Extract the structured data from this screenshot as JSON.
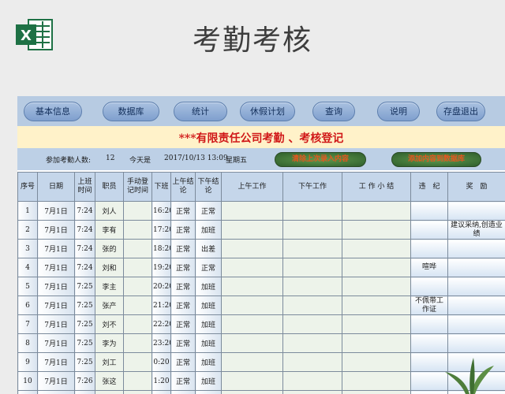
{
  "header": {
    "title": "考勤考核"
  },
  "nav": {
    "buttons": [
      "基本信息",
      "数据库",
      "统计",
      "休假计划",
      "查询",
      "说明",
      "存盘退出"
    ]
  },
  "banner": {
    "title": "***有限责任公司考勤 、考核登记"
  },
  "info": {
    "count_label": "参加考勤人数:",
    "count_value": "12",
    "today_label": "今天是",
    "datetime": "2017/10/13 13:09",
    "weekday": "星期五",
    "btn_prev": "清除上次录入内容",
    "btn_add": "添加内容到数据库"
  },
  "table": {
    "headers": [
      "序号",
      "日期",
      "上班时间",
      "职员",
      "手动登记时间",
      "下班",
      "上午结论",
      "下午结论",
      "上午工作",
      "下午工作",
      "工 作 小 结",
      "违　纪",
      "奖　励"
    ],
    "rows": [
      {
        "no": "1",
        "date": "7月1日",
        "in": "7:24",
        "name": "刘人",
        "manual": "",
        "out": "16:20",
        "am": "正常",
        "pm": "正常",
        "violation": "",
        "reward": ""
      },
      {
        "no": "2",
        "date": "7月1日",
        "in": "7:24",
        "name": "李有",
        "manual": "",
        "out": "17:20",
        "am": "正常",
        "pm": "加班",
        "violation": "",
        "reward": "建议采纳,创造业绩"
      },
      {
        "no": "3",
        "date": "7月1日",
        "in": "7:24",
        "name": "张的",
        "manual": "",
        "out": "18:20",
        "am": "正常",
        "pm": "出差",
        "violation": "",
        "reward": ""
      },
      {
        "no": "4",
        "date": "7月1日",
        "in": "7:24",
        "name": "刘和",
        "manual": "",
        "out": "19:20",
        "am": "正常",
        "pm": "正常",
        "violation": "喧哗",
        "reward": ""
      },
      {
        "no": "5",
        "date": "7月1日",
        "in": "7:25",
        "name": "李主",
        "manual": "",
        "out": "20:20",
        "am": "正常",
        "pm": "加班",
        "violation": "",
        "reward": ""
      },
      {
        "no": "6",
        "date": "7月1日",
        "in": "7:25",
        "name": "张产",
        "manual": "",
        "out": "21:20",
        "am": "正常",
        "pm": "加班",
        "violation": "不佩带工作证",
        "reward": ""
      },
      {
        "no": "7",
        "date": "7月1日",
        "in": "7:25",
        "name": "刘不",
        "manual": "",
        "out": "22:20",
        "am": "正常",
        "pm": "加班",
        "violation": "",
        "reward": ""
      },
      {
        "no": "8",
        "date": "7月1日",
        "in": "7:25",
        "name": "李为",
        "manual": "",
        "out": "23:20",
        "am": "正常",
        "pm": "加班",
        "violation": "",
        "reward": ""
      },
      {
        "no": "9",
        "date": "7月1日",
        "in": "7:25",
        "name": "刘工",
        "manual": "",
        "out": "0:20",
        "am": "正常",
        "pm": "加班",
        "violation": "",
        "reward": ""
      },
      {
        "no": "10",
        "date": "7月1日",
        "in": "7:26",
        "name": "张这",
        "manual": "",
        "out": "1:20",
        "am": "正常",
        "pm": "加班",
        "violation": "",
        "reward": ""
      },
      {
        "no": "11",
        "date": "7月1日",
        "in": "7:26",
        "name": "",
        "manual": "",
        "out": "",
        "am": "",
        "pm": "",
        "violation": "",
        "reward": ""
      }
    ]
  },
  "colors": {
    "title_red": "#d01818",
    "nav_bg": "#b7cbe2",
    "banner_bg": "#fff2c9",
    "excel_green": "#1e7145"
  }
}
